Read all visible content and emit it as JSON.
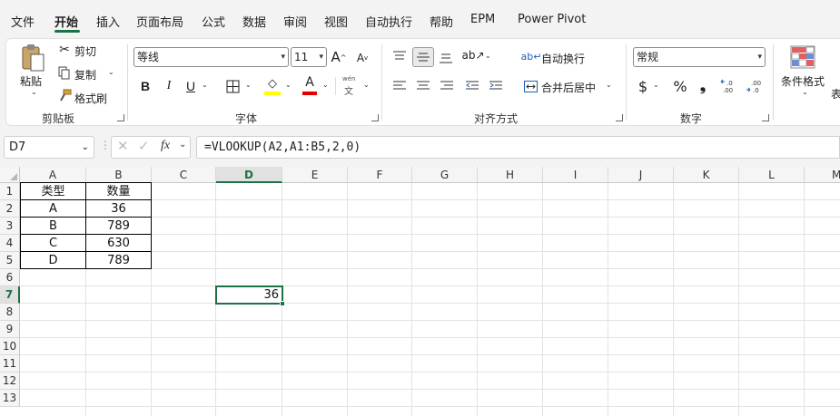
{
  "menu": {
    "tabs": [
      "文件",
      "开始",
      "插入",
      "页面布局",
      "公式",
      "数据",
      "审阅",
      "视图",
      "自动执行",
      "帮助",
      "EPM",
      "Power Pivot"
    ],
    "active_tab": "开始"
  },
  "ribbon": {
    "clipboard": {
      "paste_label": "粘贴",
      "cut_label": "剪切",
      "copy_label": "复制",
      "format_painter_label": "格式刷",
      "group_label": "剪贴板"
    },
    "font": {
      "font_name": "等线",
      "font_size": "11",
      "bold": "B",
      "italic": "I",
      "underline": "U",
      "group_label": "字体",
      "phonetic_top": "wén",
      "phonetic_bottom": "文",
      "font_color_glyph": "A"
    },
    "alignment": {
      "wrap_text_label": "自动换行",
      "merge_center_label": "合并后居中",
      "group_label": "对齐方式"
    },
    "number": {
      "format_value": "常规",
      "currency_symbol": "$",
      "percent_symbol": "%",
      "comma_symbol": "❟",
      "group_label": "数字"
    },
    "styles": {
      "conditional_format_label": "条件格式",
      "table_label_partial": "表"
    }
  },
  "formula_bar": {
    "name_box": "D7",
    "fx_label": "fx",
    "formula": "=VLOOKUP(A2,A1:B5,2,0)"
  },
  "sheet": {
    "columns": [
      "A",
      "B",
      "C",
      "D",
      "E",
      "F",
      "G",
      "H",
      "I",
      "J",
      "K",
      "L",
      "M"
    ],
    "rows": [
      "1",
      "2",
      "3",
      "4",
      "5",
      "6",
      "7",
      "8",
      "9",
      "10",
      "11",
      "12",
      "13"
    ],
    "selected_cell": "D7",
    "table": {
      "headers": [
        "类型",
        "数量"
      ],
      "rows": [
        [
          "A",
          "36"
        ],
        [
          "B",
          "789"
        ],
        [
          "C",
          "630"
        ],
        [
          "D",
          "789"
        ]
      ]
    },
    "d7_value": "36"
  },
  "colors": {
    "accent": "#1e7145",
    "highlight_yellow": "#ffff00",
    "font_red": "#e00000"
  }
}
